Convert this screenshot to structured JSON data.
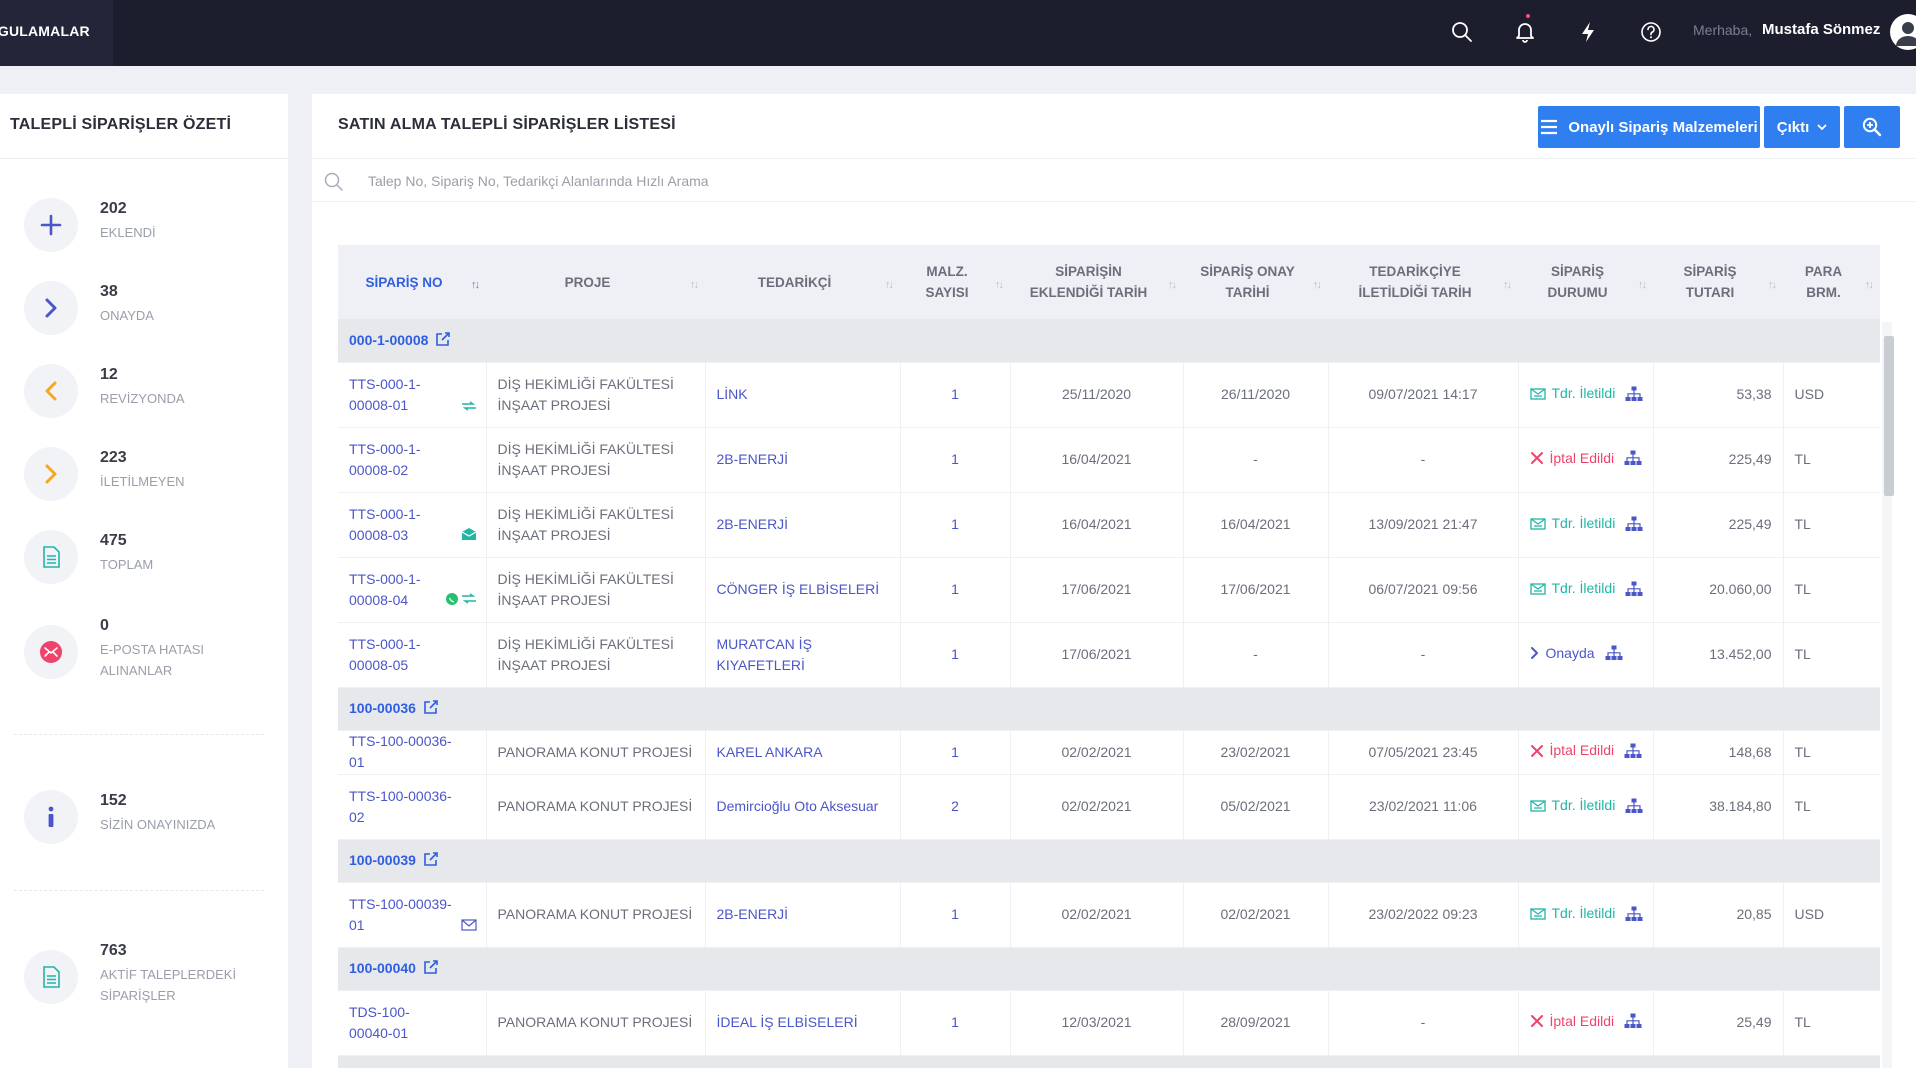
{
  "topbar": {
    "apps_label": "UYGULAMALAR",
    "greeting": "Merhaba,",
    "user_name": "Mustafa Sönmez",
    "icons": [
      "search-icon",
      "bell-icon",
      "lightning-icon",
      "help-icon",
      "avatar"
    ]
  },
  "summary": {
    "title": "TALEPLİ SİPARİŞLER ÖZETİ",
    "stats": [
      {
        "count": "202",
        "label": "EKLENDİ",
        "icon": "plus-icon",
        "color": "#4b56c8"
      },
      {
        "count": "38",
        "label": "ONAYDA",
        "icon": "chevron-right-icon",
        "color": "#4b56c8"
      },
      {
        "count": "12",
        "label": "REVİZYONDA",
        "icon": "chevron-left-icon",
        "color": "#f5a623"
      },
      {
        "count": "223",
        "label": "İLETİLMEYEN",
        "icon": "chevron-right-icon",
        "color": "#f5a623"
      },
      {
        "count": "475",
        "label": "TOPLAM",
        "icon": "document-icon",
        "color": "#20b6a6"
      },
      {
        "count": "0",
        "label": "E-POSTA HATASI ALINANLAR",
        "icon": "email-error-icon",
        "color": "#f0436b"
      },
      {
        "count": "152",
        "label": "SİZİN ONAYINIZDA",
        "icon": "info-icon",
        "color": "#4b56c8"
      },
      {
        "count": "763",
        "label": "AKTİF TALEPLERDEKİ SİPARİŞLER",
        "icon": "document-icon",
        "color": "#20b6a6"
      }
    ]
  },
  "main": {
    "title": "SATIN ALMA TALEPLİ SİPARİŞLER LİSTESİ",
    "approved_btn": "Onaylı Sipariş Malzemeleri",
    "output_btn": "Çıktı",
    "search_placeholder": "Talep No, Sipariş No, Tedarikçi Alanlarında Hızlı Arama"
  },
  "table": {
    "headers": {
      "order_no": "SİPARİŞ NO",
      "project": "PROJE",
      "supplier": "TEDARİKÇİ",
      "qty_1": "MALZ.",
      "qty_2": "SAYISI",
      "added_1": "SİPARİŞİN",
      "added_2": "EKLENDİĞİ TARİH",
      "approval_1": "SİPARİŞ ONAY",
      "approval_2": "TARİHİ",
      "sent_1": "TEDARİKÇİYE",
      "sent_2": "İLETİLDİĞİ TARİH",
      "status_1": "SİPARİŞ",
      "status_2": "DURUMU",
      "amount_1": "SİPARİŞ",
      "amount_2": "TUTARI",
      "currency_1": "PARA",
      "currency_2": "BRM."
    },
    "groups": [
      {
        "name": "000-1-00008",
        "rows": [
          {
            "order_no": "TTS-000-1-00008-01",
            "project": "DİŞ HEKİMLİĞİ FAKÜLTESİ İNŞAAT PROJESİ",
            "supplier": "LİNK",
            "qty": "1",
            "added": "25/11/2020",
            "approval": "26/11/2020",
            "sent": "09/07/2021 14:17",
            "status": "Tdr. İletildi",
            "status_type": "tdr",
            "amount": "53,38",
            "currency": "USD",
            "order_icon": "sent-icon"
          },
          {
            "order_no": "TTS-000-1-00008-02",
            "project": "DİŞ HEKİMLİĞİ FAKÜLTESİ İNŞAAT PROJESİ",
            "supplier": "2B-ENERJİ",
            "qty": "1",
            "added": "16/04/2021",
            "approval": "-",
            "sent": "-",
            "status": "İptal Edildi",
            "status_type": "iptal",
            "amount": "225,49",
            "currency": "TL",
            "order_icon": ""
          },
          {
            "order_no": "TTS-000-1-00008-03",
            "project": "DİŞ HEKİMLİĞİ FAKÜLTESİ İNŞAAT PROJESİ",
            "supplier": "2B-ENERJİ",
            "qty": "1",
            "added": "16/04/2021",
            "approval": "16/04/2021",
            "sent": "13/09/2021 21:47",
            "status": "Tdr. İletildi",
            "status_type": "tdr",
            "amount": "225,49",
            "currency": "TL",
            "order_icon": "mail-open-icon"
          },
          {
            "order_no": "TTS-000-1-00008-04",
            "project": "DİŞ HEKİMLİĞİ FAKÜLTESİ İNŞAAT PROJESİ",
            "supplier": "CÖNGER İŞ ELBİSELERİ",
            "qty": "1",
            "added": "17/06/2021",
            "approval": "17/06/2021",
            "sent": "06/07/2021 09:56",
            "status": "Tdr. İletildi",
            "status_type": "tdr",
            "amount": "20.060,00",
            "currency": "TL",
            "order_icon": "whatsapp-sent-icon"
          },
          {
            "order_no": "TTS-000-1-00008-05",
            "project": "DİŞ HEKİMLİĞİ FAKÜLTESİ İNŞAAT PROJESİ",
            "supplier": "MURATCAN İŞ KIYAFETLERİ",
            "qty": "1",
            "added": "17/06/2021",
            "approval": "-",
            "sent": "-",
            "status": "Onayda",
            "status_type": "onay",
            "amount": "13.452,00",
            "currency": "TL",
            "order_icon": ""
          }
        ]
      },
      {
        "name": "100-00036",
        "rows": [
          {
            "order_no": "TTS-100-00036-01",
            "project": "PANORAMA KONUT PROJESİ",
            "supplier": "KAREL ANKARA",
            "qty": "1",
            "added": "02/02/2021",
            "approval": "23/02/2021",
            "sent": "07/05/2021 23:45",
            "status": "İptal Edildi",
            "status_type": "iptal",
            "amount": "148,68",
            "currency": "TL",
            "order_icon": ""
          },
          {
            "order_no": "TTS-100-00036-02",
            "project": "PANORAMA KONUT PROJESİ",
            "supplier": "Demircioğlu Oto Aksesuar",
            "qty": "2",
            "added": "02/02/2021",
            "approval": "05/02/2021",
            "sent": "23/02/2021 11:06",
            "status": "Tdr. İletildi",
            "status_type": "tdr",
            "amount": "38.184,80",
            "currency": "TL",
            "order_icon": ""
          }
        ]
      },
      {
        "name": "100-00039",
        "rows": [
          {
            "order_no": "TTS-100-00039-01",
            "project": "PANORAMA KONUT PROJESİ",
            "supplier": "2B-ENERJİ",
            "qty": "1",
            "added": "02/02/2021",
            "approval": "02/02/2021",
            "sent": "23/02/2022 09:23",
            "status": "Tdr. İletildi",
            "status_type": "tdr",
            "amount": "20,85",
            "currency": "USD",
            "order_icon": "mail-icon"
          }
        ]
      },
      {
        "name": "100-00040",
        "rows": [
          {
            "order_no": "TDS-100-00040-01",
            "project": "PANORAMA KONUT PROJESİ",
            "supplier": "İDEAL İŞ ELBİSELERİ",
            "qty": "1",
            "added": "12/03/2021",
            "approval": "28/09/2021",
            "sent": "-",
            "status": "İptal Edildi",
            "status_type": "iptal",
            "amount": "25,49",
            "currency": "TL",
            "order_icon": ""
          }
        ]
      }
    ]
  }
}
